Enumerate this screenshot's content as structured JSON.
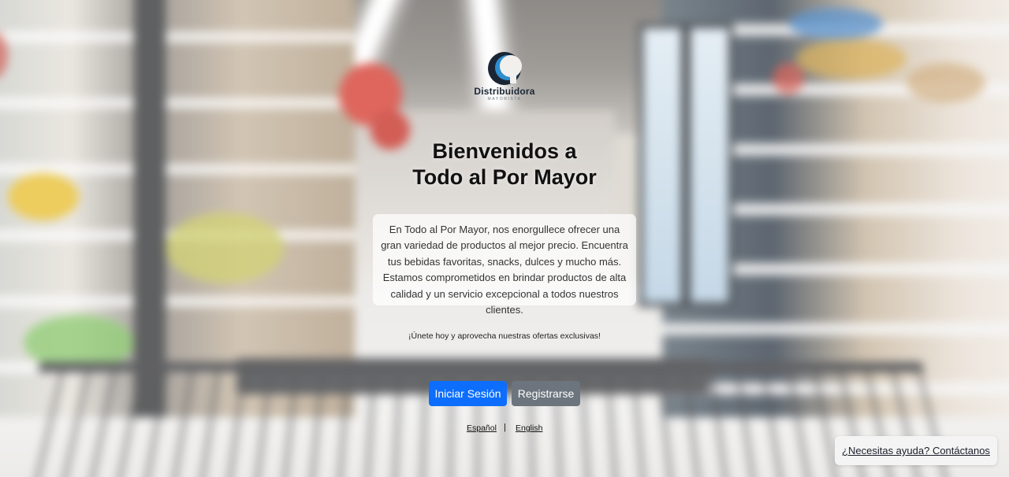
{
  "brand": {
    "name": "Distribuidora",
    "tagline": "MAYORISTA",
    "logo_icon": "circle-crescent-logo",
    "colors": {
      "primary": "#0d6efd",
      "secondary": "#6c757d",
      "dark": "#1b2635"
    }
  },
  "hero": {
    "title_line1": "Bienvenidos a",
    "title_line2": "Todo al Por Mayor",
    "description": "En Todo al Por Mayor, nos enorgullece ofrecer una gran variedad de productos al mejor precio. Encuentra tus bebidas favoritas, snacks, dulces y mucho más. Estamos comprometidos en brindar productos de alta calidad y un servicio excepcional a todos nuestros clientes.",
    "promo": "¡Únete hoy y aprovecha nuestras ofertas exclusivas!"
  },
  "actions": {
    "login_label": "Iniciar Sesión",
    "register_label": "Registrarse"
  },
  "language": {
    "spanish": "Español",
    "separator": "|",
    "english": "English"
  },
  "help": {
    "label": "¿Necesitas ayuda? Contáctanos"
  }
}
